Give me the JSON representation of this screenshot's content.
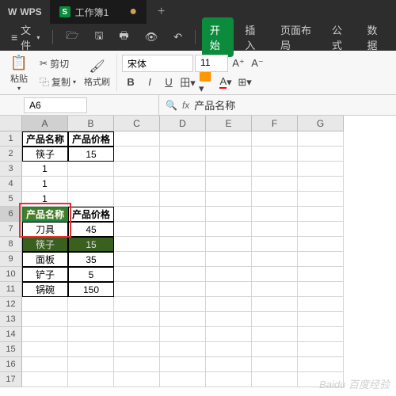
{
  "titlebar": {
    "logo": "WPS",
    "tab_name": "工作簿1",
    "new_tab": "+"
  },
  "menubar": {
    "file": "文件",
    "items": [
      "开始",
      "插入",
      "页面布局",
      "公式",
      "数据"
    ]
  },
  "toolbar": {
    "paste": "粘贴",
    "cut": "剪切",
    "copy": "复制",
    "format_brush": "格式刷",
    "font_name": "宋体",
    "font_size": "11",
    "bold": "B",
    "italic": "I",
    "underline": "U",
    "font_increase": "A⁺",
    "font_decrease": "A⁻"
  },
  "cellref": {
    "ref": "A6",
    "fx": "fx",
    "value": "产品名称"
  },
  "grid": {
    "cols": [
      "A",
      "B",
      "C",
      "D",
      "E",
      "F",
      "G"
    ],
    "rows": [
      "1",
      "2",
      "3",
      "4",
      "5",
      "6",
      "7",
      "8",
      "9",
      "10",
      "11",
      "12",
      "13",
      "14",
      "15",
      "16",
      "17"
    ],
    "data": [
      [
        "产品名称",
        "产品价格",
        "",
        "",
        "",
        "",
        ""
      ],
      [
        "筷子",
        "15",
        "",
        "",
        "",
        "",
        ""
      ],
      [
        "1",
        "",
        "",
        "",
        "",
        "",
        ""
      ],
      [
        "1",
        "",
        "",
        "",
        "",
        "",
        ""
      ],
      [
        "1",
        "",
        "",
        "",
        "",
        "",
        ""
      ],
      [
        "产品名称",
        "产品价格",
        "",
        "",
        "",
        "",
        ""
      ],
      [
        "刀具",
        "45",
        "",
        "",
        "",
        "",
        ""
      ],
      [
        "筷子",
        "15",
        "",
        "",
        "",
        "",
        ""
      ],
      [
        "面板",
        "35",
        "",
        "",
        "",
        "",
        ""
      ],
      [
        "铲子",
        "5",
        "",
        "",
        "",
        "",
        ""
      ],
      [
        "锅碗",
        "150",
        "",
        "",
        "",
        "",
        ""
      ],
      [
        "",
        "",
        "",
        "",
        "",
        "",
        ""
      ],
      [
        "",
        "",
        "",
        "",
        "",
        "",
        ""
      ],
      [
        "",
        "",
        "",
        "",
        "",
        "",
        ""
      ],
      [
        "",
        "",
        "",
        "",
        "",
        "",
        ""
      ],
      [
        "",
        "",
        "",
        "",
        "",
        "",
        ""
      ],
      [
        "",
        "",
        "",
        "",
        "",
        "",
        ""
      ]
    ]
  },
  "watermark": "Baidu 百度经验"
}
